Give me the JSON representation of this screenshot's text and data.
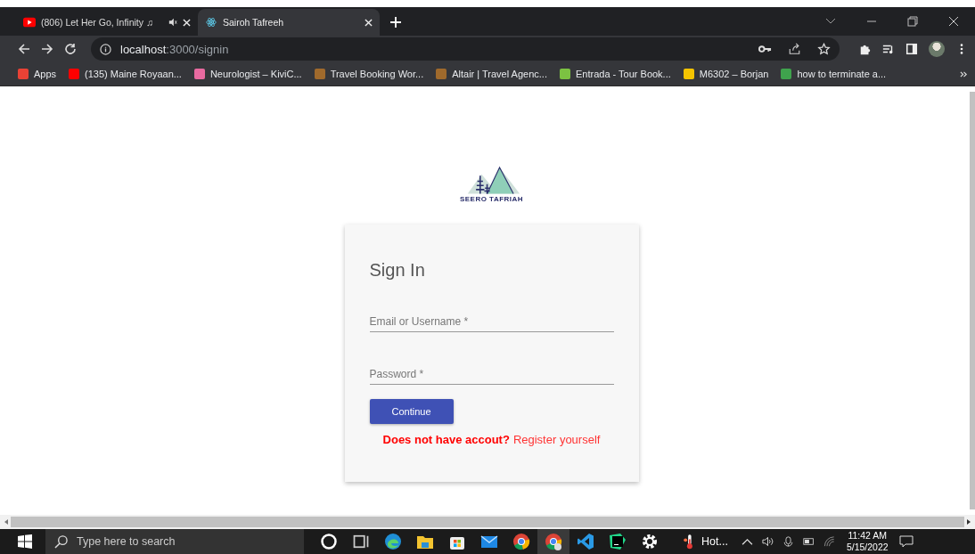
{
  "tabs": [
    {
      "title": "(806) Let Her Go, Infinity ♫",
      "selected": false,
      "audio": true
    },
    {
      "title": "Sairoh Tafreeh",
      "selected": true,
      "audio": false
    }
  ],
  "address": {
    "host": "localhost",
    "path": ":3000/signin"
  },
  "bookmarks": [
    {
      "label": "Apps",
      "color": "#e94235"
    },
    {
      "label": "(135) Maine Royaan...",
      "color": "#ff0000"
    },
    {
      "label": "Neurologist – KiviC...",
      "color": "#e86aa0"
    },
    {
      "label": "Travel Booking Wor...",
      "color": "#a06a2c"
    },
    {
      "label": "Altair | Travel Agenc...",
      "color": "#a06a2c"
    },
    {
      "label": "Entrada - Tour Book...",
      "color": "#7cc242"
    },
    {
      "label": "M6302 – Borjan",
      "color": "#f5c400"
    },
    {
      "label": "how to terminate a...",
      "color": "#3fa34d"
    }
  ],
  "logo": {
    "text": "SEERO TAFRIAH"
  },
  "form": {
    "title": "Sign In",
    "fields": [
      {
        "placeholder": "Email or Username *"
      },
      {
        "placeholder": "Password *"
      }
    ],
    "button": "Continue",
    "prompt": "Does not have accout?",
    "link": "Register yourself"
  },
  "taskbar": {
    "search_placeholder": "Type here to search",
    "weather": "Hot...",
    "time": "11:42 AM",
    "date": "5/15/2022"
  }
}
